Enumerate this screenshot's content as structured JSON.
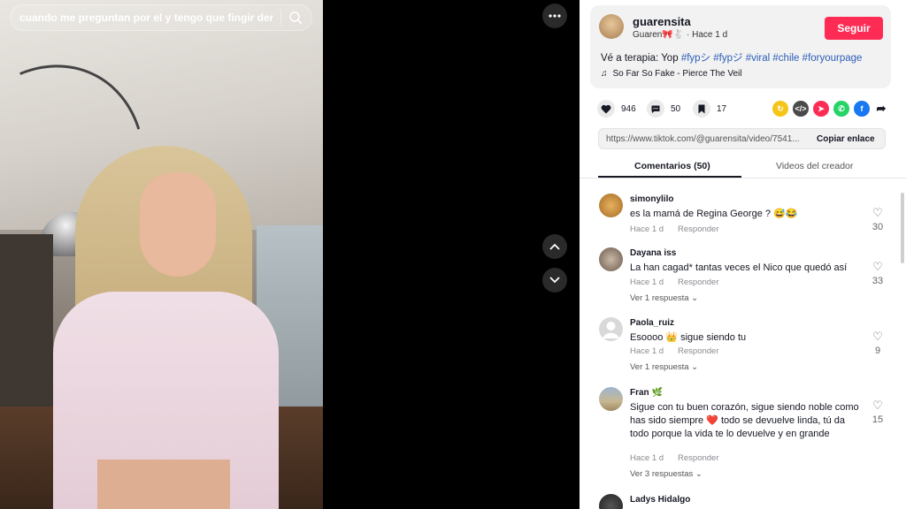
{
  "search": {
    "query": "cuando me preguntan por el y tengo que fingir demencia"
  },
  "icons": {
    "search": "search-icon",
    "more": "ellipsis-icon",
    "prev": "chevron-up-icon",
    "next": "chevron-down-icon",
    "like": "heart-icon",
    "comment": "comment-icon",
    "save": "bookmark-icon",
    "music": "music-note-icon"
  },
  "author": {
    "username": "guarensita",
    "display_meta": "Guaren🎀🐇 · Hace 1 d",
    "follow_label": "Seguir"
  },
  "post": {
    "caption_prefix": "Vé a terapia: Yop",
    "hashtags": [
      "#fypシ",
      "#fypジ",
      "#viral",
      "#chile",
      "#foryourpage"
    ],
    "music": "So Far So Fake - Pierce The Veil"
  },
  "stats": {
    "likes": "946",
    "comments": "50",
    "saves": "17"
  },
  "share": {
    "link": "https://www.tiktok.com/@guarensita/video/7541...",
    "copy_label": "Copiar enlace",
    "colors": [
      "#f5c518",
      "#4a4a4a",
      "#fe2c55",
      "#25d366",
      "#1877f2"
    ]
  },
  "tabs": {
    "comments_label": "Comentarios (50)",
    "creator_videos_label": "Videos del creador"
  },
  "comment_list": [
    {
      "user": "simonylilo",
      "text": "es la mamá de Regina George ? 😅😂",
      "time": "Hace 1 d",
      "reply_label": "Responder",
      "likes": "30",
      "replies": ""
    },
    {
      "user": "Dayana iss",
      "text": "La han cagad* tantas veces el Nico que quedó así",
      "time": "Hace 1 d",
      "reply_label": "Responder",
      "likes": "33",
      "replies": "Ver 1 respuesta ⌄"
    },
    {
      "user": "Paola_ruiz",
      "text": "Esoooo 👑 sigue siendo tu",
      "time": "Hace 1 d",
      "reply_label": "Responder",
      "likes": "9",
      "replies": "Ver 1 respuesta ⌄"
    },
    {
      "user": "Fran 🌿",
      "text": "Sigue con tu buen corazón, sigue siendo noble como has sido siempre ❤️ todo se devuelve linda, tú da todo porque la vida te lo devuelve y en grande",
      "time": "Hace 1 d",
      "reply_label": "Responder",
      "likes": "15",
      "replies": "Ver 3 respuestas ⌄"
    },
    {
      "user": "Ladys Hidalgo",
      "text": "",
      "time": "",
      "reply_label": "",
      "likes": "",
      "replies": ""
    }
  ]
}
